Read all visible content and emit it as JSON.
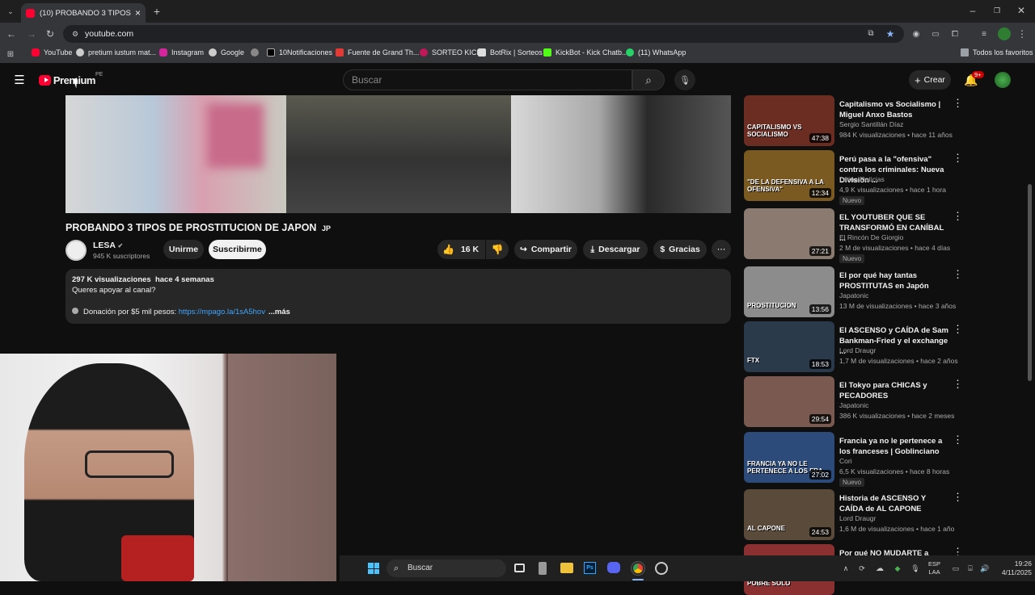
{
  "browser": {
    "tab_title": "(10) PROBANDO 3 TIPOS DE PR...",
    "url": "youtube.com",
    "all_bookmarks": "Todos los favoritos",
    "bookmarks": [
      "YouTube",
      "pretium iustum mat...",
      "Instagram",
      "Google",
      "",
      "10Notificaciones",
      "Fuente de Grand Th...",
      "SORTEO KICK",
      "BotRix | Sorteos",
      "KickBot - Kick Chatb...",
      "(11) WhatsApp"
    ]
  },
  "youtube": {
    "logo": "Premium",
    "country": "PE",
    "search_placeholder": "Buscar",
    "create_label": "Crear",
    "notif_badge": "9+"
  },
  "video": {
    "title": "PROBANDO 3 TIPOS DE PROSTITUCION DE JAPON",
    "flag": "JP",
    "channel": "LESA",
    "subscribers": "945 K suscriptores",
    "join": "Unirme",
    "subscribe": "Suscribirme",
    "likes": "16 K",
    "share": "Compartir",
    "download": "Descargar",
    "thanks": "Gracias",
    "views_date": "297 K visualizaciones  hace 4 semanas",
    "desc_line1": "Queres apoyar al canal?",
    "desc_line2": "Donación por $5 mil pesos: ",
    "desc_link": "https://mpago.la/1sA5hov",
    "desc_more": "...más"
  },
  "related": [
    {
      "title": "Capitalismo vs Socialismo | Miguel Anxo Bastos",
      "channel": "Sergio Santillán Díaz",
      "meta": "984 K visualizaciones • hace 11 años",
      "duration": "47:38",
      "new": "",
      "thumb": "#6b2c22",
      "thumb_text": "CAPITALISMO VS SOCIALISMO"
    },
    {
      "title": "Perú pasa a la \"ofensiva\" contra los criminales: Nueva División ...",
      "channel": "Latina Noticias",
      "meta": "4,9 K visualizaciones • hace 1 hora",
      "duration": "12:34",
      "new": "Nuevo",
      "thumb": "#7a5a20",
      "thumb_text": "\"DE LA DEFENSIVA A LA OFENSIVA\""
    },
    {
      "title": "EL YOUTUBER QUE SE TRANSFORMÓ EN CANÍBAL ...",
      "channel": "El Rincón De Giorgio",
      "meta": "2 M de visualizaciones • hace 4 días",
      "duration": "27:21",
      "new": "Nuevo",
      "thumb": "#8a7a70",
      "thumb_text": ""
    },
    {
      "title": "El por qué hay tantas PROSTITUTAS en Japón",
      "channel": "Japatonic",
      "meta": "13 M de visualizaciones • hace 3 años",
      "duration": "13:56",
      "new": "",
      "thumb": "#8c8c8c",
      "thumb_text": "PROSTITUCION"
    },
    {
      "title": "El ASCENSO y CAÍDA de Sam Bankman-Fried y el exchange ...",
      "channel": "Lord Draugr",
      "meta": "1,7 M de visualizaciones • hace 2 años",
      "duration": "18:53",
      "new": "",
      "thumb": "#2b3a4a",
      "thumb_text": "FTX"
    },
    {
      "title": "El Tokyo para CHICAS y PECADORES",
      "channel": "Japatonic",
      "meta": "386 K visualizaciones • hace 2 meses",
      "duration": "29:54",
      "new": "",
      "thumb": "#7a5a50",
      "thumb_text": ""
    },
    {
      "title": "Francia ya no le pertenece a los franceses | Goblinciano",
      "channel": "Cori",
      "meta": "6,5 K visualizaciones • hace 8 horas",
      "duration": "27:02",
      "new": "Nuevo",
      "thumb": "#2c4a7a",
      "thumb_text": "FRANCIA YA NO LE PERTENECE A LOS FRA"
    },
    {
      "title": "Historia de ASCENSO Y CAÍDA de AL CAPONE",
      "channel": "Lord Draugr",
      "meta": "1,6 M de visualizaciones • hace 1 año",
      "duration": "24:53",
      "new": "",
      "thumb": "#5a4a3a",
      "thumb_text": "AL CAPONE"
    },
    {
      "title": "Por qué NO MUDARTE a",
      "channel": "",
      "meta": "",
      "duration": "",
      "new": "",
      "thumb": "#8a3030",
      "thumb_text": "POBRE SOLO"
    }
  ],
  "taskbar": {
    "search": "Buscar",
    "lang1": "ESP",
    "lang2": "LAA",
    "time": "19:26",
    "date": "4/11/2025"
  }
}
